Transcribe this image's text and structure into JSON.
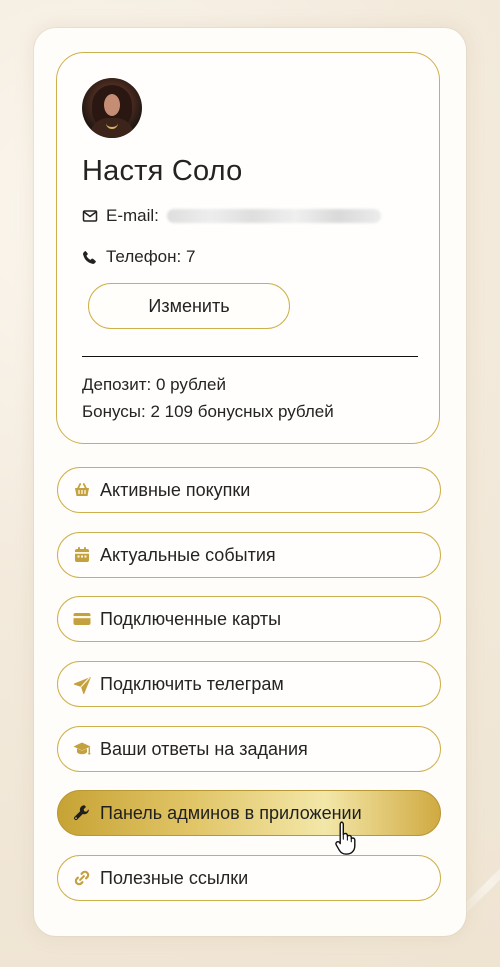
{
  "profile": {
    "name": "Настя Соло",
    "email_label": "E-mail:",
    "phone_label": "Телефон: 7",
    "edit_button": "Изменить",
    "deposit_text": "Депозит: 0 рублей",
    "bonuses_text": "Бонусы: 2 109 бонусных рублей"
  },
  "menu": {
    "items": [
      {
        "label": "Активные покупки",
        "icon": "basket-icon"
      },
      {
        "label": "Актуальные события",
        "icon": "calendar-icon"
      },
      {
        "label": "Подключенные карты",
        "icon": "card-icon"
      },
      {
        "label": "Подключить телеграм",
        "icon": "paper-plane-icon"
      },
      {
        "label": "Ваши ответы на задания",
        "icon": "graduation-cap-icon"
      },
      {
        "label": "Панель админов в приложении",
        "icon": "wrench-icon",
        "active": true
      },
      {
        "label": "Полезные ссылки",
        "icon": "link-icon"
      }
    ]
  },
  "colors": {
    "accent_gold": "#cdb04b",
    "active_gold_start": "#c7a335",
    "active_gold_end": "#f3e7a8",
    "text_dark": "#242424",
    "background": "#f3eadc"
  }
}
